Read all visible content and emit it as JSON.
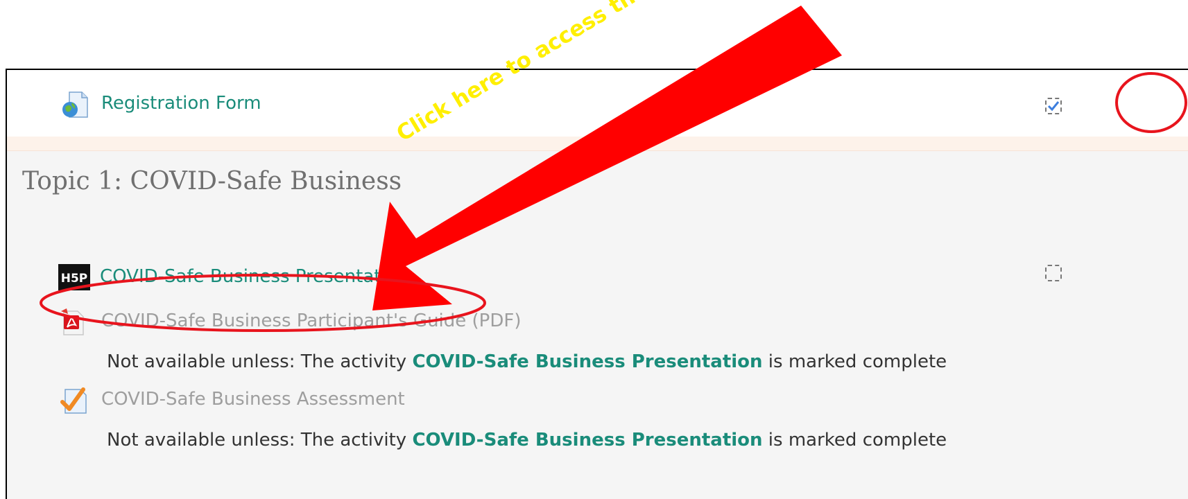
{
  "activities": {
    "registration": {
      "label": "Registration Form",
      "icon": "globe-document-icon"
    },
    "presentation": {
      "label": "COVID-Safe Business Presentation",
      "icon": "h5p-icon",
      "icon_text": "H5P"
    },
    "guide": {
      "label": "COVID-Safe Business Participant's Guide (PDF)",
      "icon": "pdf-icon"
    },
    "assessment": {
      "label": "COVID-Safe Business Assessment",
      "icon": "quiz-checkmark-icon"
    }
  },
  "section": {
    "title": "Topic 1: COVID-Safe Business"
  },
  "restrictions": [
    {
      "prefix": "Not available unless: The activity ",
      "activity": "COVID-Safe Business Presentation",
      "suffix": " is marked complete"
    },
    {
      "prefix": "Not available unless: The activity ",
      "activity": "COVID-Safe Business Presentation",
      "suffix": " is marked complete"
    }
  ],
  "completion": {
    "registration": {
      "checked": true
    },
    "presentation": {
      "checked": false
    }
  },
  "annotation": {
    "text": "Click here to access the presentation",
    "arrow_color": "#ff0000",
    "text_color": "#ffef00",
    "circle_color": "#e8141d"
  },
  "colors": {
    "link": "#1a8c7a",
    "dimmed": "#9e9e9e",
    "section_bg": "#f5f5f5",
    "highlight_band": "#fdf2ea"
  }
}
